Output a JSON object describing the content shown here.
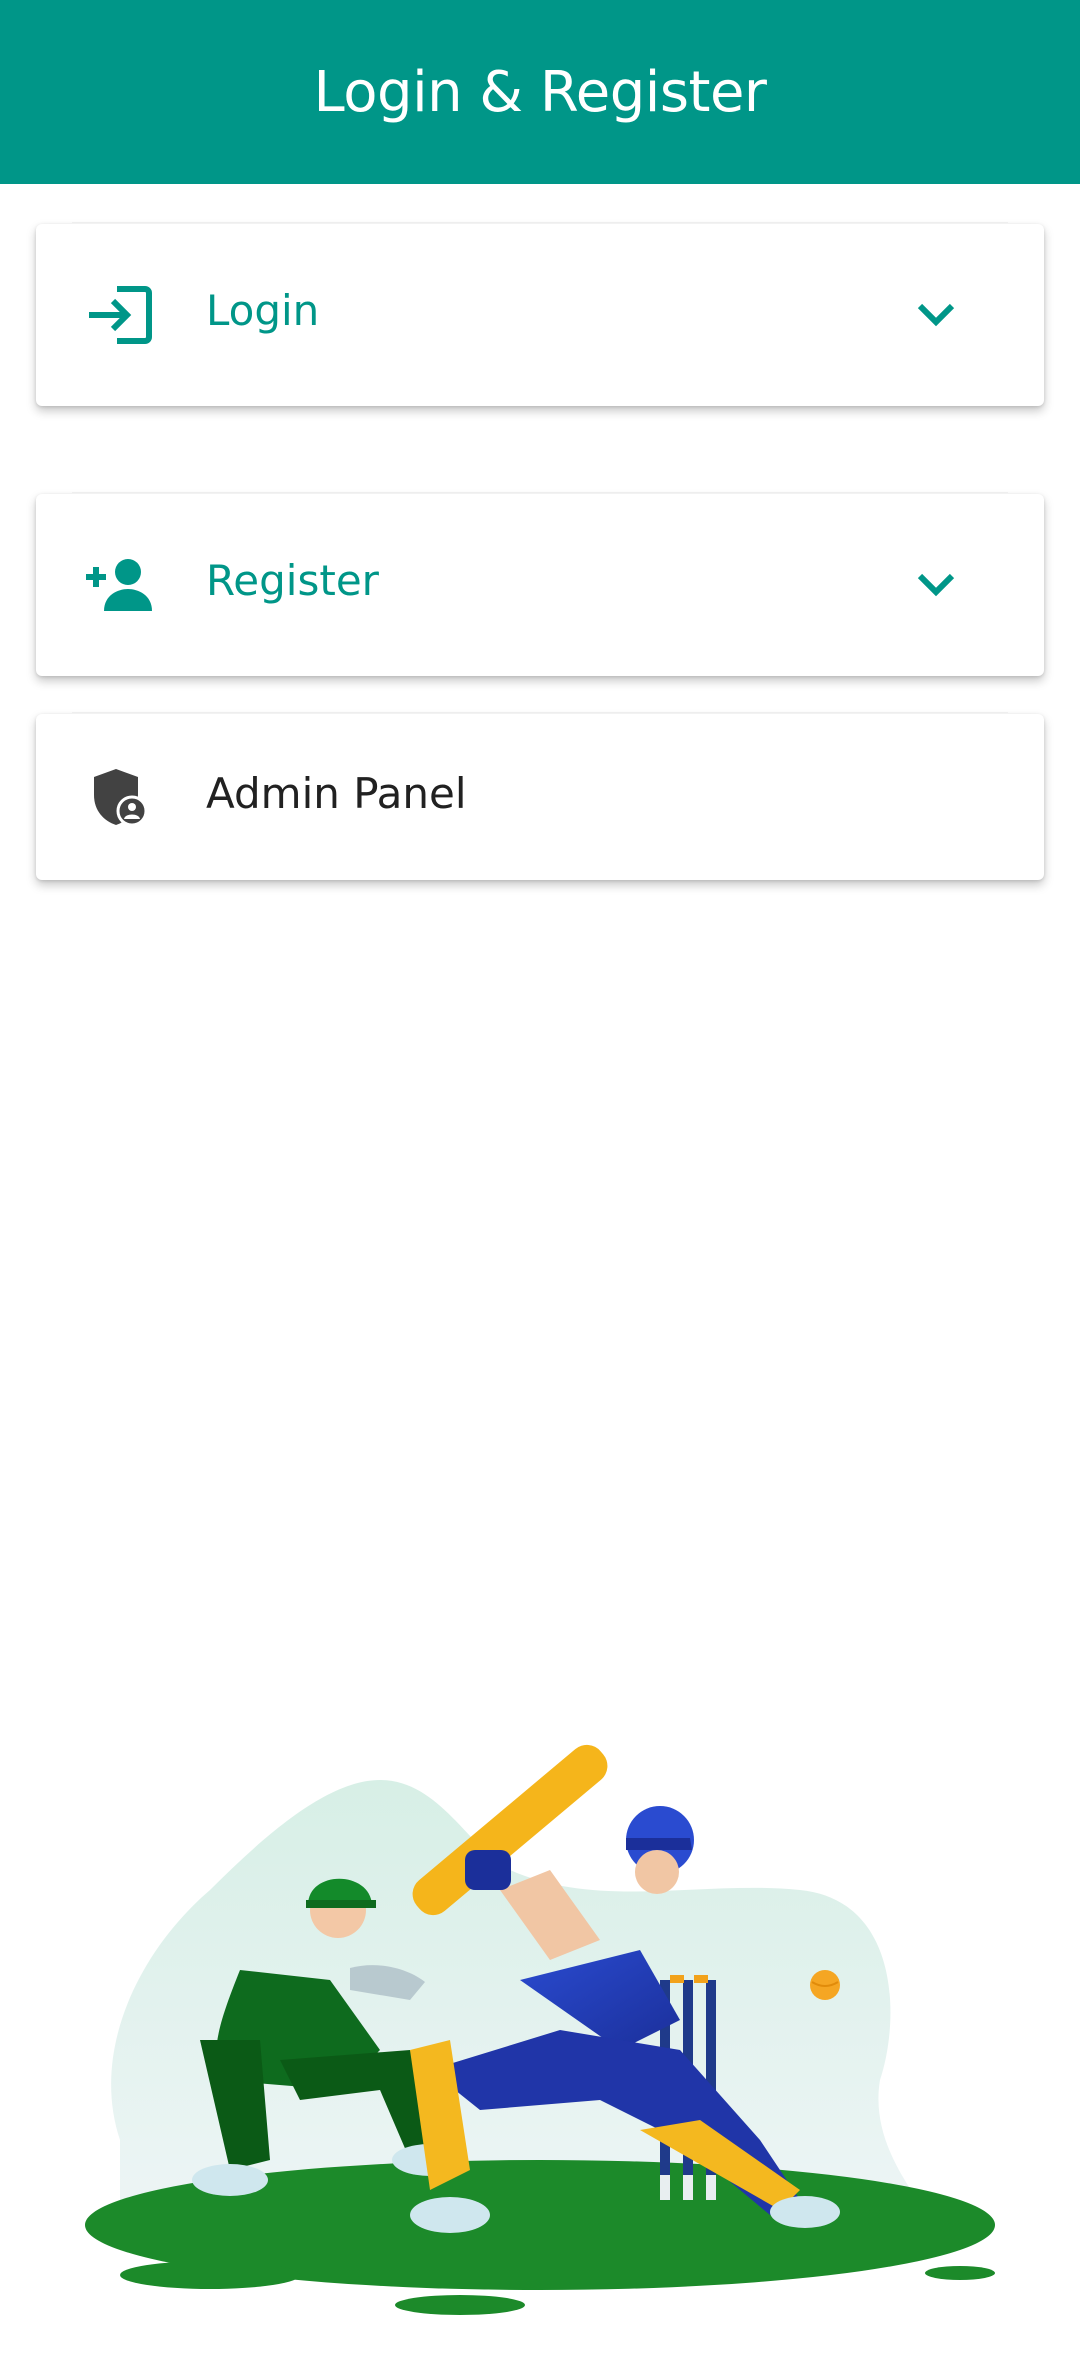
{
  "appbar": {
    "title": "Login & Register"
  },
  "menu": {
    "items": [
      {
        "label": "Login",
        "icon": "login-icon",
        "expandable": true
      },
      {
        "label": "Register",
        "icon": "person-add-icon",
        "expandable": true
      },
      {
        "label": "Admin Panel",
        "icon": "admin-shield-icon",
        "expandable": false
      }
    ]
  },
  "colors": {
    "primary": "#009688",
    "text_dark": "#212121",
    "icon_dark": "#424242"
  },
  "illustration": {
    "subject": "cricket-batsman-and-wicketkeeper"
  }
}
